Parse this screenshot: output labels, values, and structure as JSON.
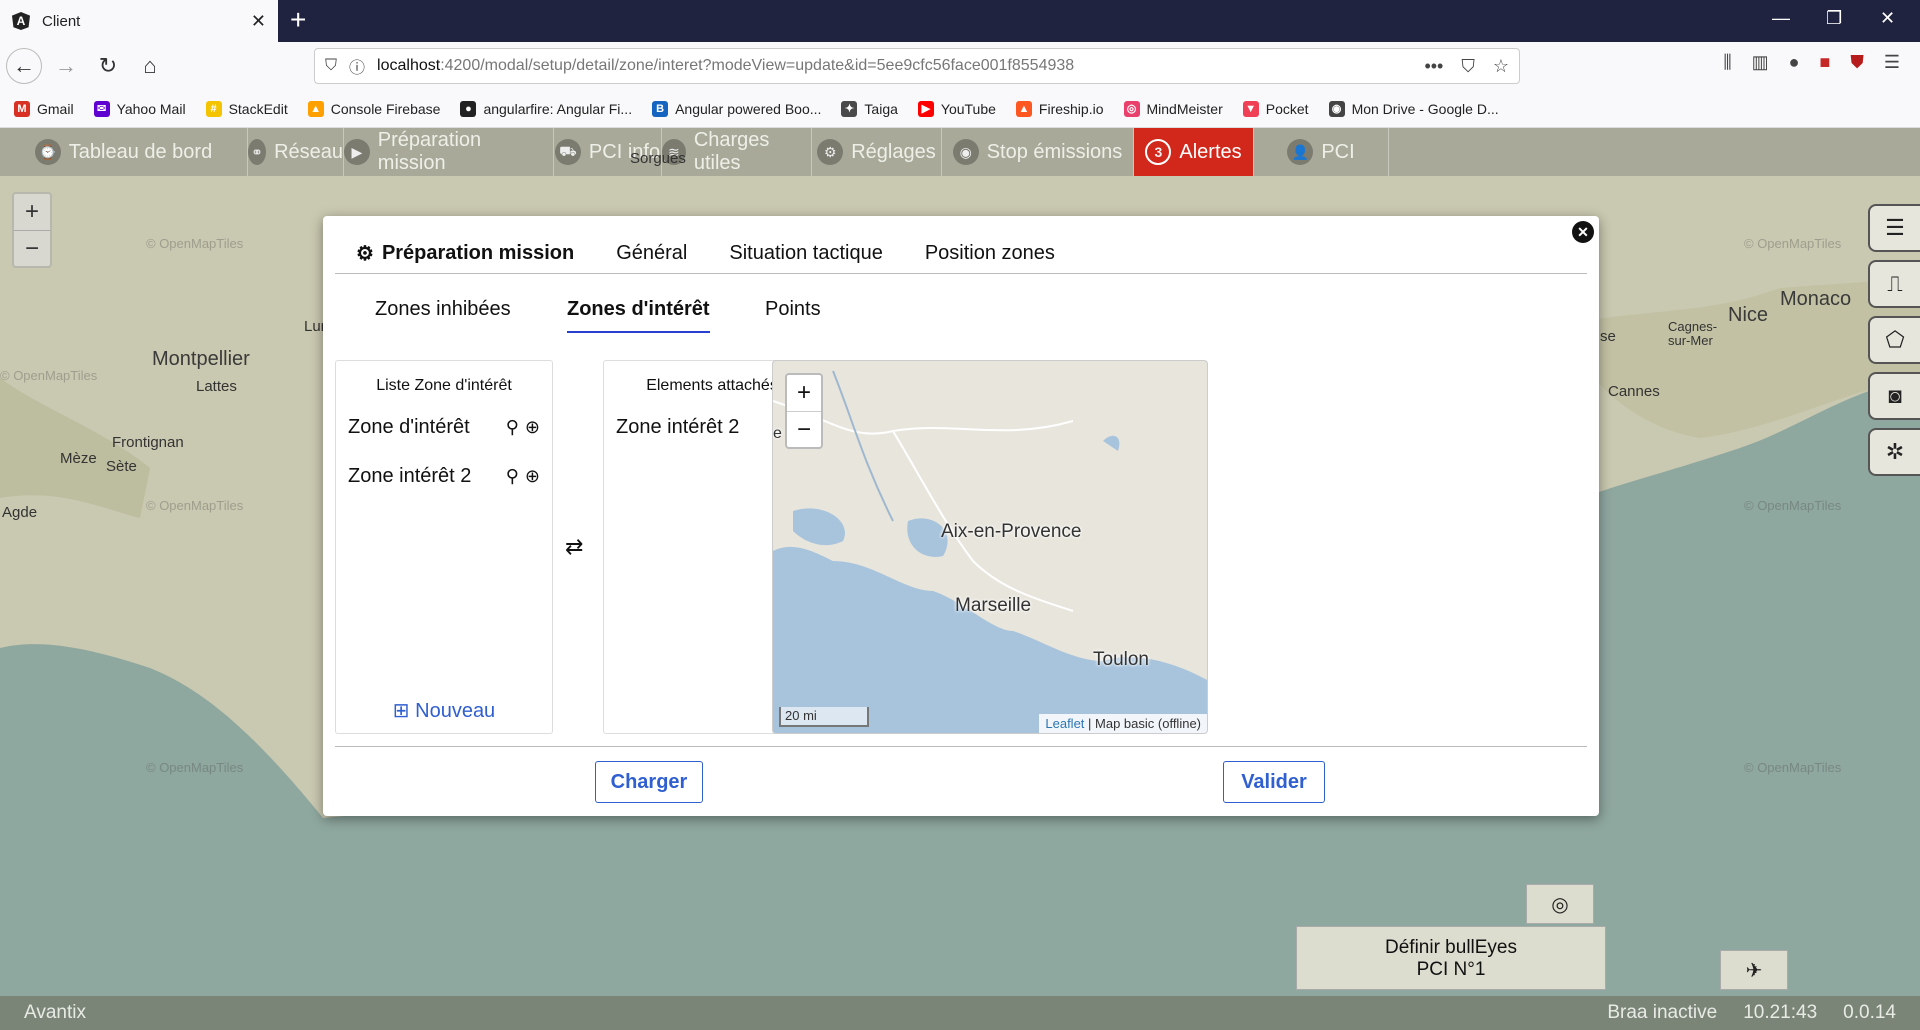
{
  "browser": {
    "tab_title": "Client",
    "url_host": "localhost",
    "url_path": ":4200/modal/setup/detail/zone/interet?modeView=update&id=5ee9cfc56face001f8554938",
    "bookmarks": [
      {
        "label": "Gmail",
        "color": "#d93025",
        "icon": "M"
      },
      {
        "label": "Yahoo Mail",
        "color": "#5f01d1",
        "icon": "✉"
      },
      {
        "label": "StackEdit",
        "color": "#f5c400",
        "icon": "#"
      },
      {
        "label": "Console Firebase",
        "color": "#ffa000",
        "icon": "▲"
      },
      {
        "label": "angularfire: Angular Fi...",
        "color": "#222",
        "icon": "●"
      },
      {
        "label": "Angular powered Boo...",
        "color": "#1565c0",
        "icon": "B"
      },
      {
        "label": "Taiga",
        "color": "#4a4a4a",
        "icon": "✦"
      },
      {
        "label": "YouTube",
        "color": "#ff0000",
        "icon": "▶"
      },
      {
        "label": "Fireship.io",
        "color": "#ff5722",
        "icon": "▲"
      },
      {
        "label": "MindMeister",
        "color": "#e9416c",
        "icon": "◎"
      },
      {
        "label": "Pocket",
        "color": "#ef4056",
        "icon": "▼"
      },
      {
        "label": "Mon Drive - Google D...",
        "color": "#444",
        "icon": "◉"
      }
    ]
  },
  "topnav": [
    {
      "label": "Tableau de bord",
      "icon": "⌚",
      "width": 248
    },
    {
      "label": "Réseau",
      "icon": "⚭",
      "width": 96
    },
    {
      "label": "Préparation mission",
      "icon": "▶",
      "width": 210
    },
    {
      "label": "PCI info",
      "icon": "⛟",
      "width": 108
    },
    {
      "label": "Charges utiles",
      "icon": "≋",
      "width": 150
    },
    {
      "label": "Réglages",
      "icon": "⚙",
      "width": 130
    },
    {
      "label": "Stop émissions",
      "icon": "◉",
      "width": 192
    },
    {
      "label": "Alertes",
      "icon": "3",
      "width": 120,
      "alert": true
    },
    {
      "label": "PCI",
      "icon": "👤",
      "width": 135
    }
  ],
  "map": {
    "labels": [
      "Sorgues",
      "Montpellier",
      "Lattes",
      "Frontignan",
      "Mèze",
      "Sète",
      "Agde",
      "Lun",
      "Monaco",
      "Nice",
      "Cagnes-sur-Mer",
      "Cannes",
      "se"
    ],
    "watermark": "© OpenMapTiles"
  },
  "modal": {
    "tabs": [
      "Préparation mission",
      "Général",
      "Situation tactique",
      "Position zones"
    ],
    "subtabs": [
      "Zones inhibées",
      "Zones d'intérêt",
      "Points"
    ],
    "list_panel": {
      "title": "Liste Zone d'intérêt",
      "items": [
        "Zone d'intérêt",
        "Zone intérêt 2"
      ],
      "new_label": "Nouveau"
    },
    "attached_panel": {
      "title": "Elements attachés",
      "items": [
        "Zone intérêt 2"
      ]
    },
    "minimap": {
      "labels": [
        "Aix-en-Provence",
        "Marseille",
        "Toulon",
        "e"
      ],
      "scale": "20 mi",
      "attribution_link": "Leaflet",
      "attribution_text": " | Map basic (offline)"
    },
    "buttons": {
      "load": "Charger",
      "validate": "Valider"
    }
  },
  "bulleyes": {
    "line1": "Définir bullEyes",
    "line2": "PCI N°1"
  },
  "status": {
    "left": "Avantix",
    "braa": "Braa inactive",
    "time": "10.21:43",
    "version": "0.0.14"
  }
}
